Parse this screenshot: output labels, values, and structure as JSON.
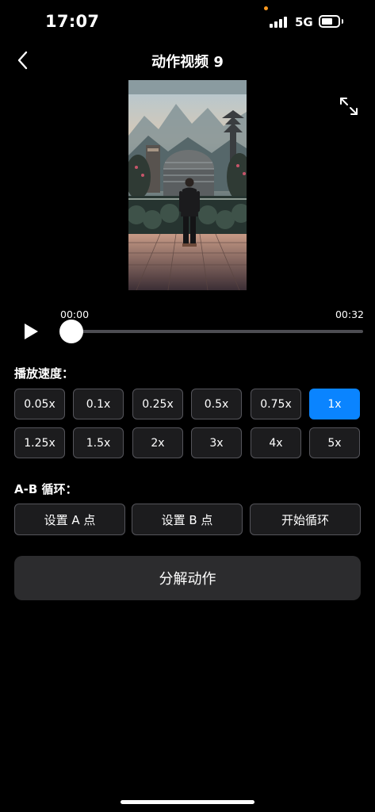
{
  "status_bar": {
    "time": "17:07",
    "network": "5G",
    "signal-icon": "signal-bars-icon",
    "battery-icon": "battery-icon"
  },
  "nav": {
    "title": "动作视频 9",
    "back_icon": "chevron-left-icon",
    "fullscreen_icon": "expand-arrows-icon"
  },
  "player": {
    "current_time": "00:00",
    "duration": "00:32",
    "progress": 0,
    "play_icon": "play-icon"
  },
  "speed": {
    "label": "播放速度：",
    "options": [
      "0.05x",
      "0.1x",
      "0.25x",
      "0.5x",
      "0.75x",
      "1x",
      "1.25x",
      "1.5x",
      "2x",
      "3x",
      "4x",
      "5x"
    ],
    "selected": "1x",
    "accent_color": "#0a84ff"
  },
  "ab_loop": {
    "label": "A-B 循环：",
    "set_a": "设置 A 点",
    "set_b": "设置 B 点",
    "start_loop": "开始循环"
  },
  "actions": {
    "decompose": "分解动作"
  }
}
